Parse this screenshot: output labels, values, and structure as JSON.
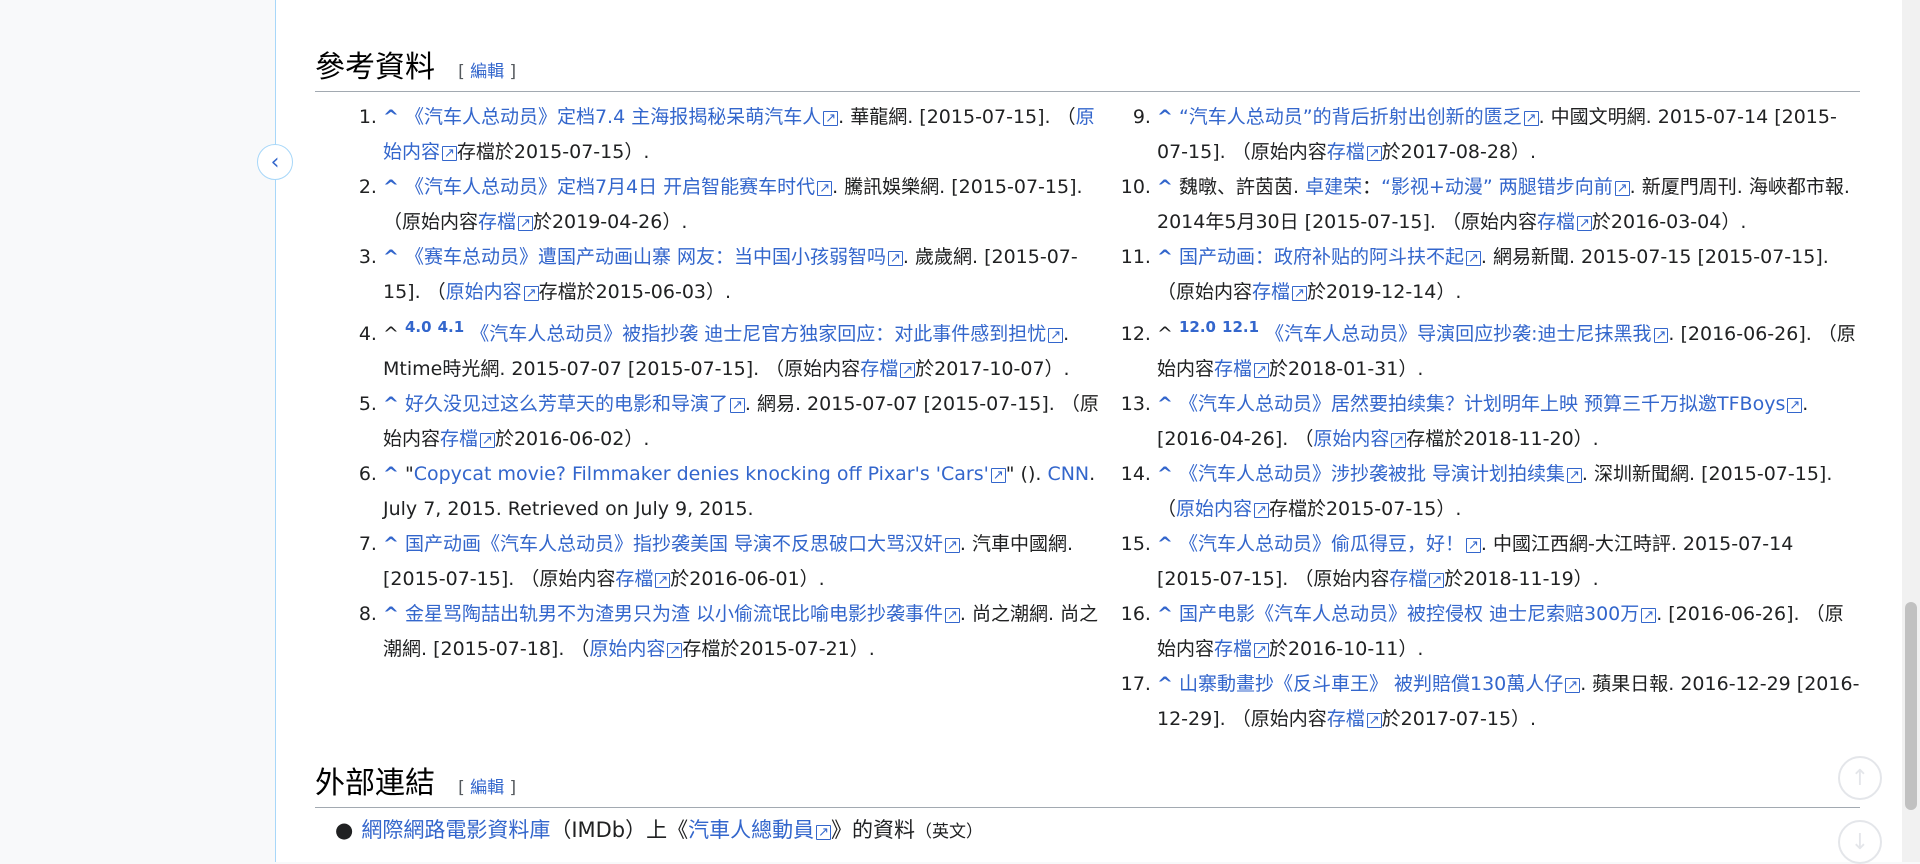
{
  "sections": {
    "references": {
      "title": "參考資料",
      "edit_open": "[ ",
      "edit_label": "編輯",
      "edit_close": " ]"
    },
    "external": {
      "title": "外部連結",
      "edit_open": "[ ",
      "edit_label": "編輯",
      "edit_close": " ]"
    }
  },
  "refs": {
    "r1": {
      "caret": "^",
      "link": "《汽车人总动员》定档7.4 主海报揭秘呆萌汽车人",
      "t1": ". 華龍網. [2015-07-15]. （",
      "a1": "原始内容",
      "t2": "存檔於2015-07-15）."
    },
    "r2": {
      "caret": "^",
      "link": "《汽车人总动员》定档7月4日 开启智能赛车时代",
      "t1": ". 騰訊娛樂網. [2015-07-15]. （原始内容",
      "a1": "存檔",
      "t2": "於2019-04-26）."
    },
    "r3": {
      "caret": "^",
      "link": "《赛车总动员》遭国产动画山寨 网友：当中国小孩弱智吗",
      "t1": ". 歲歲網. [2015-07-15]. （",
      "a1": "原始内容",
      "t2": "存檔於2015-06-03）."
    },
    "r4": {
      "caret": "^",
      "s1": "4.0",
      "s2": "4.1",
      "link": "《汽车人总动员》被指抄袭 迪士尼官方独家回应：对此事件感到担忧",
      "t1": ". Mtime時光網. 2015-07-07 [2015-07-15]. （原始内容",
      "a1": "存檔",
      "t2": "於2017-10-07）."
    },
    "r5": {
      "caret": "^",
      "link": "好久没见过这么芳草天的电影和导演了",
      "t1": ". 網易. 2015-07-07 [2015-07-15]. （原始内容",
      "a1": "存檔",
      "t2": "於2016-06-02）."
    },
    "r6": {
      "caret": "^",
      "q1": "\"",
      "link": "Copycat movie? Filmmaker denies knocking off Pixar's 'Cars'",
      "q2": "\" ().",
      "a1": "CNN",
      "t2": ". July 7, 2015. Retrieved on July 9, 2015."
    },
    "r7": {
      "caret": "^",
      "link": "国产动画《汽车人总动员》指抄袭美国 导演不反思破口大骂汉奸",
      "t1": ". 汽車中國網. [2015-07-15]. （原始内容",
      "a1": "存檔",
      "t2": "於2016-06-01）."
    },
    "r8": {
      "caret": "^",
      "link": "金星骂陶喆出轨男不为渣男只为渣 以小偷流氓比喻电影抄袭事件",
      "t1": ". 尚之潮網. 尚之潮網. [2015-07-18]. （",
      "a1": "原始内容",
      "t2": "存檔於2015-07-21）."
    },
    "r9": {
      "caret": "^",
      "link": "“汽车人总动员”的背后折射出创新的匮乏",
      "t1": ". 中國文明網. 2015-07-14 [2015-07-15]. （原始内容",
      "a1": "存檔",
      "t2": "於2017-08-28）."
    },
    "r10": {
      "caret": "^",
      "pre": "魏暾、許茵茵. ",
      "link0": "卓建荣",
      "mid": "：",
      "link": "“影视+动漫” 两腿错步向前",
      "t1": ". 新厦門周刊. 海峽都市報. 2014年5月30日 [2015-07-15]. （原始内容",
      "a1": "存檔",
      "t2": "於2016-03-04）."
    },
    "r11": {
      "caret": "^",
      "link": "国产动画：政府补贴的阿斗扶不起",
      "t1": ". 網易新聞. 2015-07-15 [2015-07-15]. （原始内容",
      "a1": "存檔",
      "t2": "於2019-12-14）."
    },
    "r12": {
      "caret": "^",
      "s1": "12.0",
      "s2": "12.1",
      "link": "《汽车人总动员》导演回应抄袭:迪士尼抹黑我",
      "t1": ". [2016-06-26]. （原始内容",
      "a1": "存檔",
      "t2": "於2018-01-31）."
    },
    "r13": {
      "caret": "^",
      "link": "《汽车人总动员》居然要拍续集？计划明年上映 预算三千万拟邀TFBoys",
      "t1": ". [2016-04-26]. （",
      "a1": "原始内容",
      "t2": "存檔於2018-11-20）."
    },
    "r14": {
      "caret": "^",
      "link": "《汽车人总动员》涉抄袭被批 导演计划拍续集",
      "t1": ". 深圳新聞網. [2015-07-15]. （",
      "a1": "原始内容",
      "t2": "存檔於2015-07-15）."
    },
    "r15": {
      "caret": "^",
      "link": "《汽车人总动员》偷瓜得豆，好！",
      "t1": ". 中國江西網-大江時評. 2015-07-14 [2015-07-15]. （原始内容",
      "a1": "存檔",
      "t2": "於2018-11-19）."
    },
    "r16": {
      "caret": "^",
      "link": "国产电影《汽车人总动员》被控侵权 迪士尼索赔300万",
      "t1": ". [2016-06-26]. （原始内容",
      "a1": "存檔",
      "t2": "於2016-10-11）."
    },
    "r17": {
      "caret": "^",
      "link": "山寨動畫抄《反斗車王》 被判賠償130萬人仔",
      "t1": ". 蘋果日報. 2016-12-29 [2016-12-29]. （原始内容",
      "a1": "存檔",
      "t2": "於2017-07-15）."
    }
  },
  "external_links": {
    "bullet": "●",
    "link1": "網際網路電影資料庫",
    "t1": "（IMDb）上《",
    "link2": "汽車人總動員",
    "t2": "》的資料",
    "lang": "（英文）"
  },
  "icons": {
    "collapse": "chevron-left-icon",
    "scroll_top": "arrow-up-circle-icon",
    "scroll_bottom": "arrow-down-circle-icon"
  }
}
